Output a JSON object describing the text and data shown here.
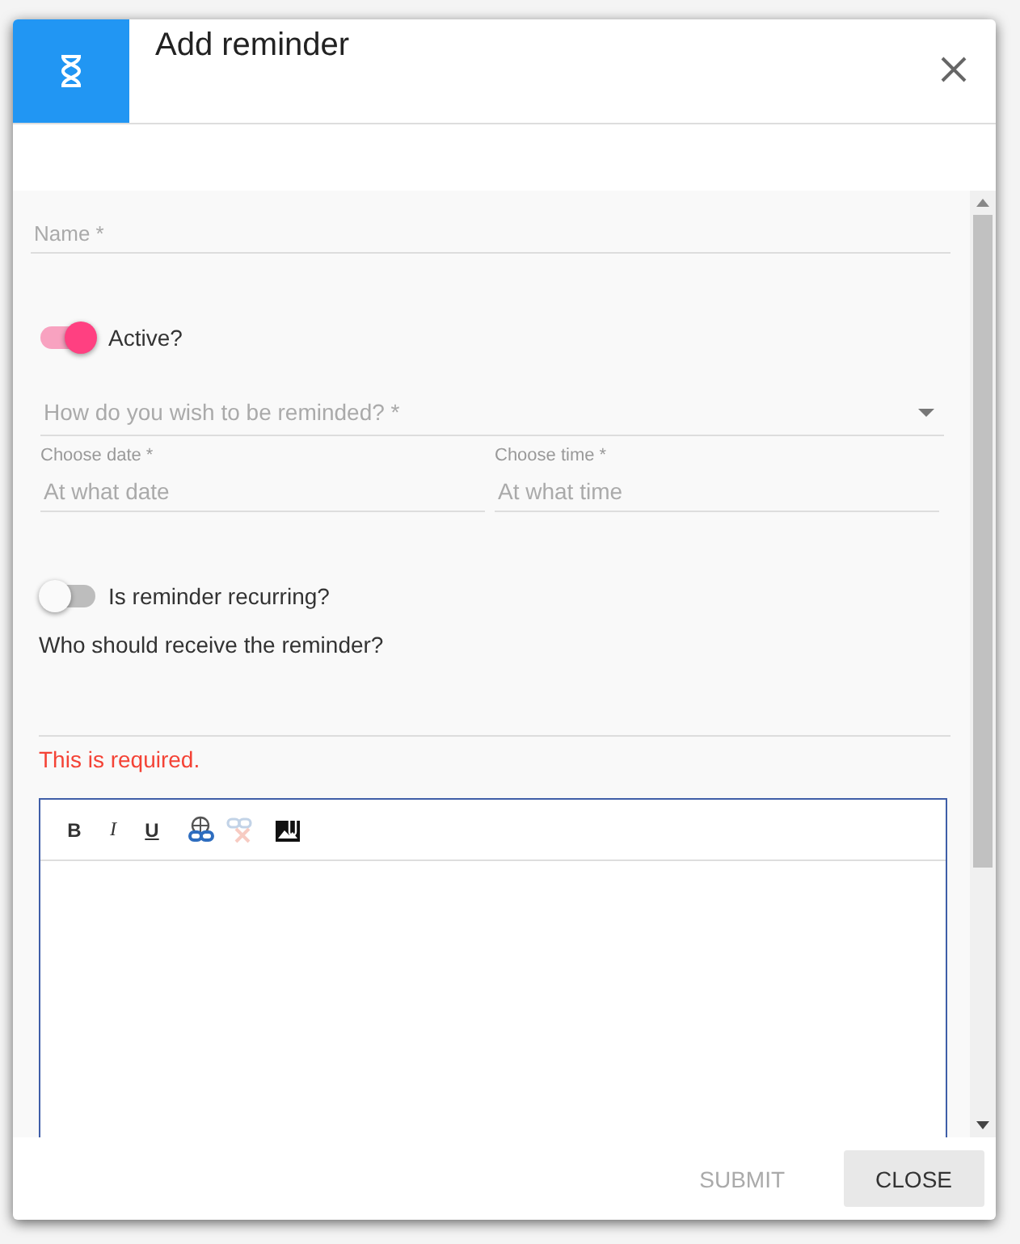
{
  "dialog": {
    "title": "Add reminder"
  },
  "form": {
    "name": {
      "placeholder": "Name *"
    },
    "active": {
      "label": "Active?",
      "on": true
    },
    "method": {
      "placeholder": "How do you wish to be reminded? *"
    },
    "date": {
      "label": "Choose date *",
      "placeholder": "At what date"
    },
    "time": {
      "label": "Choose time *",
      "placeholder": "At what time"
    },
    "recurring": {
      "label": "Is reminder recurring?",
      "on": false
    },
    "recipients": {
      "label": "Who should receive the reminder?",
      "error": "This is required."
    },
    "editor": {
      "toolbar": [
        {
          "kind": "bold",
          "label": "B",
          "disabled": false
        },
        {
          "kind": "italic",
          "label": "I",
          "disabled": false
        },
        {
          "kind": "underline",
          "label": "U",
          "disabled": false
        },
        {
          "kind": "link",
          "disabled": false
        },
        {
          "kind": "unlink",
          "disabled": true
        },
        {
          "kind": "image",
          "disabled": false
        }
      ]
    }
  },
  "buttons": [
    {
      "label": "SUBMIT",
      "disabled": true
    },
    {
      "label": "CLOSE",
      "disabled": false
    }
  ]
}
